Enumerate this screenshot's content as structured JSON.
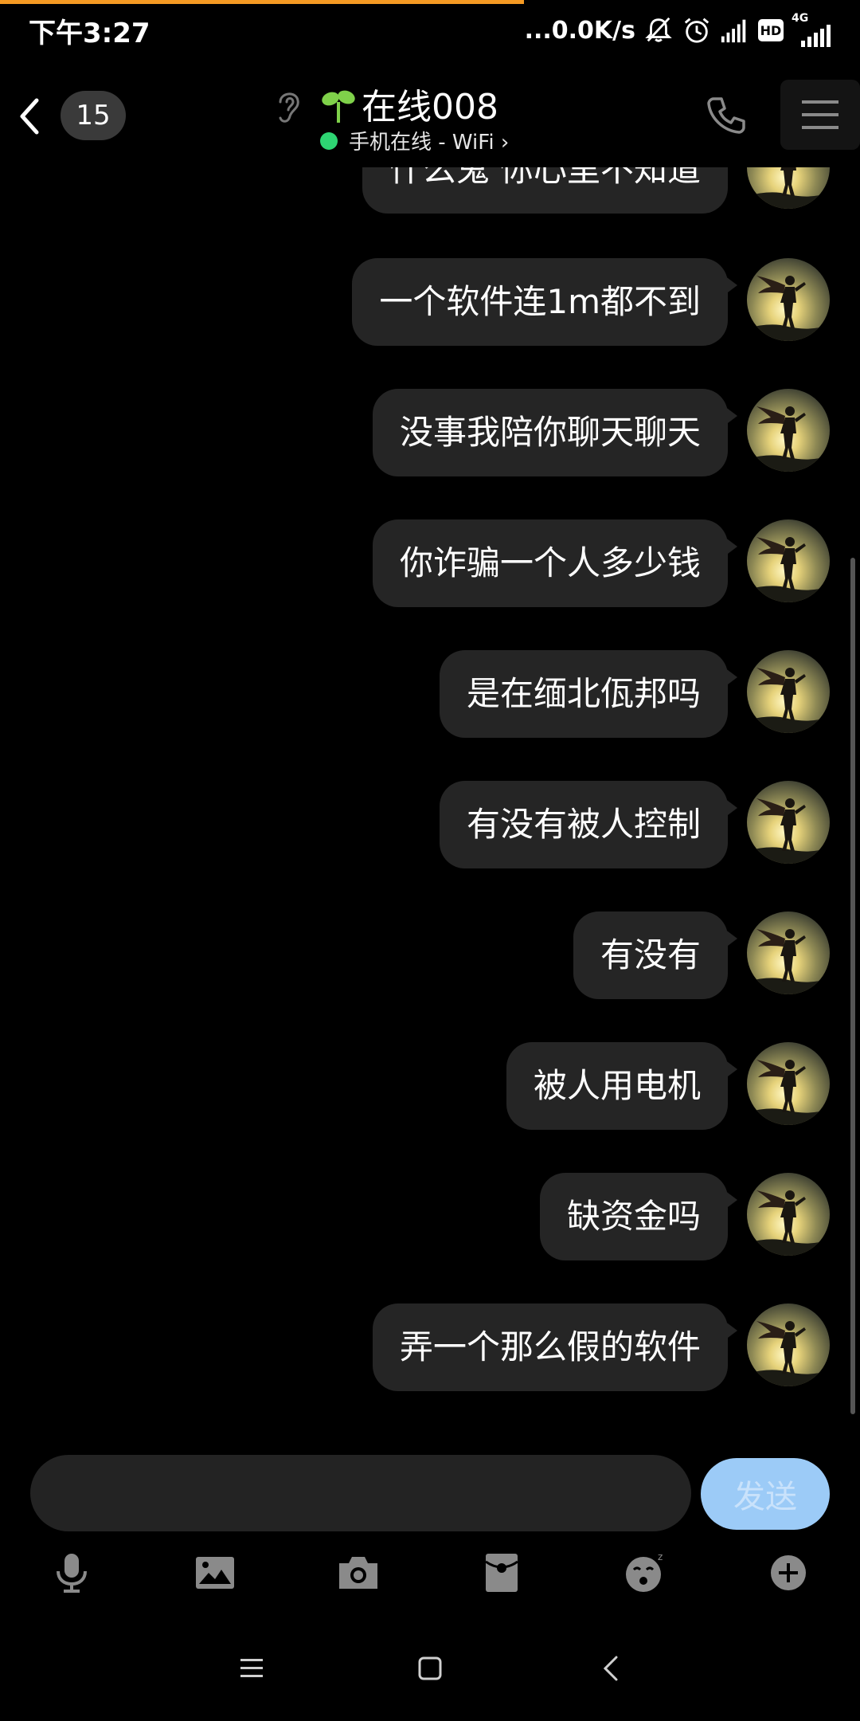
{
  "status_bar": {
    "time": "下午3:27",
    "network_speed": "...0.0K/s",
    "hd_label": "HD",
    "net_type": "4G",
    "icons": [
      "mute-bell-icon",
      "alarm-icon",
      "signal-icon",
      "hd-icon",
      "signal-4g-icon"
    ]
  },
  "header": {
    "unread_count": "15",
    "contact_name": "在线008",
    "online_status": "手机在线 - WiFi",
    "icons": [
      "back-icon",
      "ear-icon",
      "sprout-icon",
      "phone-icon",
      "menu-icon"
    ]
  },
  "messages": [
    {
      "text": "什么鬼 你心里不知道",
      "side": "right"
    },
    {
      "text": "一个软件连1m都不到",
      "side": "right"
    },
    {
      "text": "没事我陪你聊天聊天",
      "side": "right"
    },
    {
      "text": "你诈骗一个人多少钱",
      "side": "right"
    },
    {
      "text": "是在缅北佤邦吗",
      "side": "right"
    },
    {
      "text": "有没有被人控制",
      "side": "right"
    },
    {
      "text": "有没有",
      "side": "right"
    },
    {
      "text": "被人用电机",
      "side": "right"
    },
    {
      "text": "缺资金吗",
      "side": "right"
    },
    {
      "text": "弄一个那么假的软件",
      "side": "right"
    }
  ],
  "input": {
    "placeholder": "",
    "send_label": "发送"
  },
  "toolbar": {
    "items": [
      "mic-icon",
      "image-icon",
      "camera-icon",
      "red-packet-icon",
      "emoji-icon",
      "plus-icon"
    ]
  },
  "nav": {
    "items": [
      "nav-menu-icon",
      "nav-home-icon",
      "nav-back-icon"
    ]
  },
  "colors": {
    "background": "#000000",
    "bubble": "#252525",
    "send_button": "#9ccbf7",
    "online_dot": "#2ed573",
    "progress": "#f59a23"
  }
}
